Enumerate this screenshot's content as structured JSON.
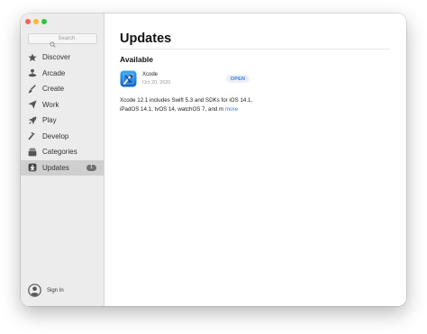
{
  "window": {
    "traffic_lights": [
      "#fe5f57",
      "#febc2e",
      "#28c840"
    ]
  },
  "sidebar": {
    "search": {
      "placeholder": "Search"
    },
    "items": [
      {
        "label": "Discover",
        "icon": "star-icon"
      },
      {
        "label": "Arcade",
        "icon": "joystick-icon"
      },
      {
        "label": "Create",
        "icon": "brush-icon"
      },
      {
        "label": "Work",
        "icon": "paper-plane-icon"
      },
      {
        "label": "Play",
        "icon": "rocket-icon"
      },
      {
        "label": "Develop",
        "icon": "hammer-icon"
      },
      {
        "label": "Categories",
        "icon": "stack-icon"
      },
      {
        "label": "Updates",
        "icon": "download-icon",
        "badge": "1",
        "active": true
      }
    ],
    "sign_in": {
      "label": "Sign In",
      "icon": "person-circle-icon"
    }
  },
  "main": {
    "title": "Updates",
    "section": "Available",
    "app": {
      "name": "Xcode",
      "date": "Oct 20, 2020",
      "button": "OPEN",
      "icon": "xcode-icon",
      "notes": "Xcode 12.1 includes Swift 5.3 and SDKs for iOS 14.1, iPadOS 14.1, tvOS 14, watchOS 7, and m",
      "more": "more"
    }
  },
  "colors": {
    "accent": "#2f7ae5",
    "sidebar_bg": "#ececec",
    "active_item_bg": "#cfcfcf",
    "badge_bg": "#6e6e6e"
  }
}
